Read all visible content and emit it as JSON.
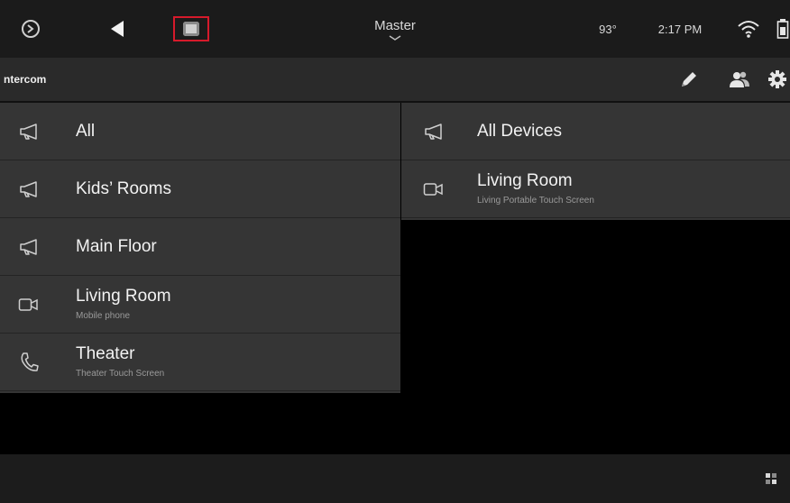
{
  "topbar": {
    "room": "Master",
    "temperature": "93°",
    "time": "2:17 PM",
    "icons": [
      "home-icon",
      "back-icon",
      "device-icon",
      "chevron-down-icon",
      "wifi-icon",
      "battery-icon"
    ],
    "highlight_color": "#d61a2b"
  },
  "subbar": {
    "title": "ntercom",
    "icons": [
      "edit-icon",
      "users-icon",
      "gear-icon"
    ]
  },
  "left_list": [
    {
      "icon": "megaphone-icon",
      "name": "All",
      "sub": ""
    },
    {
      "icon": "megaphone-icon",
      "name": "Kids’ Rooms",
      "sub": ""
    },
    {
      "icon": "megaphone-icon",
      "name": "Main Floor",
      "sub": ""
    },
    {
      "icon": "video-icon",
      "name": "Living Room",
      "sub": "Mobile phone"
    },
    {
      "icon": "phone-icon",
      "name": "Theater",
      "sub": "Theater Touch Screen"
    }
  ],
  "right_list": [
    {
      "icon": "megaphone-icon",
      "name": "All Devices",
      "sub": ""
    },
    {
      "icon": "video-icon",
      "name": "Living Room",
      "sub": "Living Portable Touch Screen"
    }
  ],
  "bottombar": {
    "icon": "extension-icon"
  }
}
